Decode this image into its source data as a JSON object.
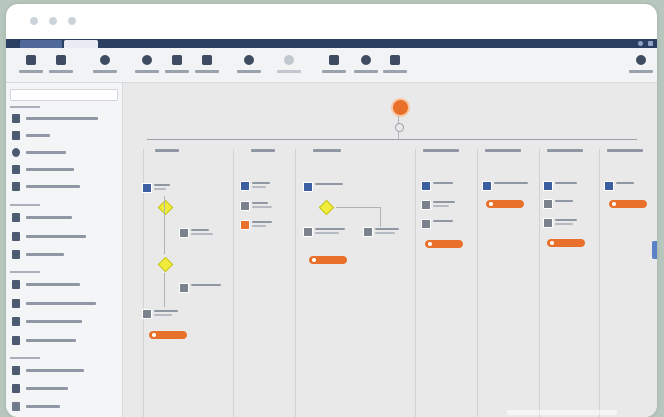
{
  "colors": {
    "titlebar_dots": "#ccd3da",
    "tabbar": "#2b3f63",
    "tab_inactive": "#4f6a9a",
    "tab_active": "#e9edf3",
    "ribbon_icon": "#3e4b61",
    "node_blue": "#3b5fa0",
    "node_gray": "#7b828c",
    "node_orange": "#e8702a",
    "decision": "#f0ec3a",
    "accent": "#5b82c6"
  },
  "icons": {
    "window_dots": [
      "window-dot-icon",
      "window-dot-icon",
      "window-dot-icon"
    ],
    "ribbon": [
      "save-icon",
      "check-icon",
      "zoom-in-icon",
      "zoom-out-icon",
      "fit-icon",
      "grid-icon",
      "undo-icon",
      "redo-icon",
      "table-icon",
      "globe-icon",
      "add-icon",
      "settings-icon"
    ],
    "sidebar": [
      "hand-icon",
      "mail-icon",
      "clock-icon",
      "document-icon",
      "document-icon",
      "database-icon",
      "document-icon",
      "document-icon",
      "database-icon",
      "document-icon",
      "document-icon",
      "document-icon",
      "table-icon",
      "table-icon",
      "check-icon"
    ],
    "start": "start-event-icon"
  },
  "canvas": {
    "lanes": 8,
    "nodes": {
      "blue": 11,
      "gray": 9,
      "orange": 9
    },
    "decisions": 3
  }
}
